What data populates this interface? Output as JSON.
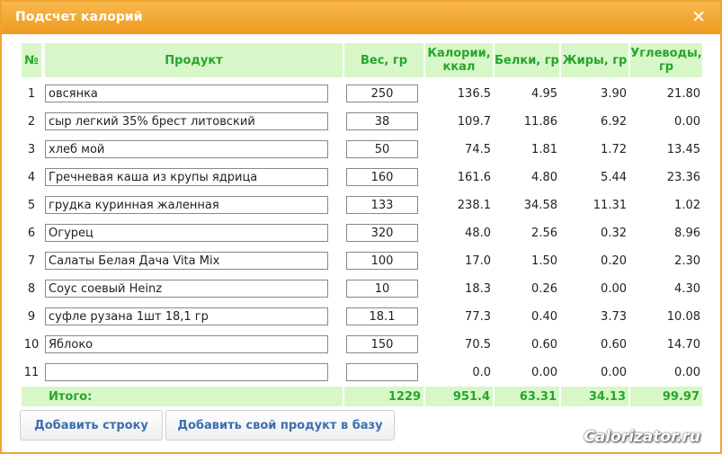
{
  "window": {
    "title": "Подсчет калорий",
    "close_glyph": "✕"
  },
  "table": {
    "headers": {
      "num": "№",
      "product": "Продукт",
      "weight": "Вес, гр",
      "calories": "Калории, ккал",
      "protein": "Белки, гр",
      "fat": "Жиры, гр",
      "carbs": "Углеводы, гр"
    },
    "rows": [
      {
        "n": "1",
        "product": "овсянка",
        "weight": "250",
        "calories": "136.5",
        "protein": "4.95",
        "fat": "3.90",
        "carbs": "21.80"
      },
      {
        "n": "2",
        "product": "сыр легкий 35% брест литовский",
        "weight": "38",
        "calories": "109.7",
        "protein": "11.86",
        "fat": "6.92",
        "carbs": "0.00"
      },
      {
        "n": "3",
        "product": "хлеб мой",
        "weight": "50",
        "calories": "74.5",
        "protein": "1.81",
        "fat": "1.72",
        "carbs": "13.45"
      },
      {
        "n": "4",
        "product": "Гречневая каша из крупы ядрица",
        "weight": "160",
        "calories": "161.6",
        "protein": "4.80",
        "fat": "5.44",
        "carbs": "23.36"
      },
      {
        "n": "5",
        "product": "грудка куринная жаленная",
        "weight": "133",
        "calories": "238.1",
        "protein": "34.58",
        "fat": "11.31",
        "carbs": "1.02"
      },
      {
        "n": "6",
        "product": "Огурец",
        "weight": "320",
        "calories": "48.0",
        "protein": "2.56",
        "fat": "0.32",
        "carbs": "8.96"
      },
      {
        "n": "7",
        "product": "Салаты Белая Дача Vita Mix",
        "weight": "100",
        "calories": "17.0",
        "protein": "1.50",
        "fat": "0.20",
        "carbs": "2.30"
      },
      {
        "n": "8",
        "product": "Соус соевый Heinz",
        "weight": "10",
        "calories": "18.3",
        "protein": "0.26",
        "fat": "0.00",
        "carbs": "4.30"
      },
      {
        "n": "9",
        "product": "суфле рузана 1шт 18,1 гр",
        "weight": "18.1",
        "calories": "77.3",
        "protein": "0.40",
        "fat": "3.73",
        "carbs": "10.08"
      },
      {
        "n": "10",
        "product": "Яблоко",
        "weight": "150",
        "calories": "70.5",
        "protein": "0.60",
        "fat": "0.60",
        "carbs": "14.70"
      },
      {
        "n": "11",
        "product": "",
        "weight": "",
        "calories": "0.0",
        "protein": "0.00",
        "fat": "0.00",
        "carbs": "0.00"
      }
    ],
    "total": {
      "label": "Итого:",
      "weight": "1229",
      "calories": "951.4",
      "protein": "63.31",
      "fat": "34.13",
      "carbs": "99.97"
    }
  },
  "buttons": {
    "add_row": "Добавить строку",
    "add_product": "Добавить свой продукт в базу"
  },
  "brand": "Calorizator.ru",
  "colors": {
    "titlebar": "#ef9a20",
    "header_bg": "#d8f7c8",
    "header_text": "#27a52c",
    "button_text": "#3b6fb0"
  }
}
